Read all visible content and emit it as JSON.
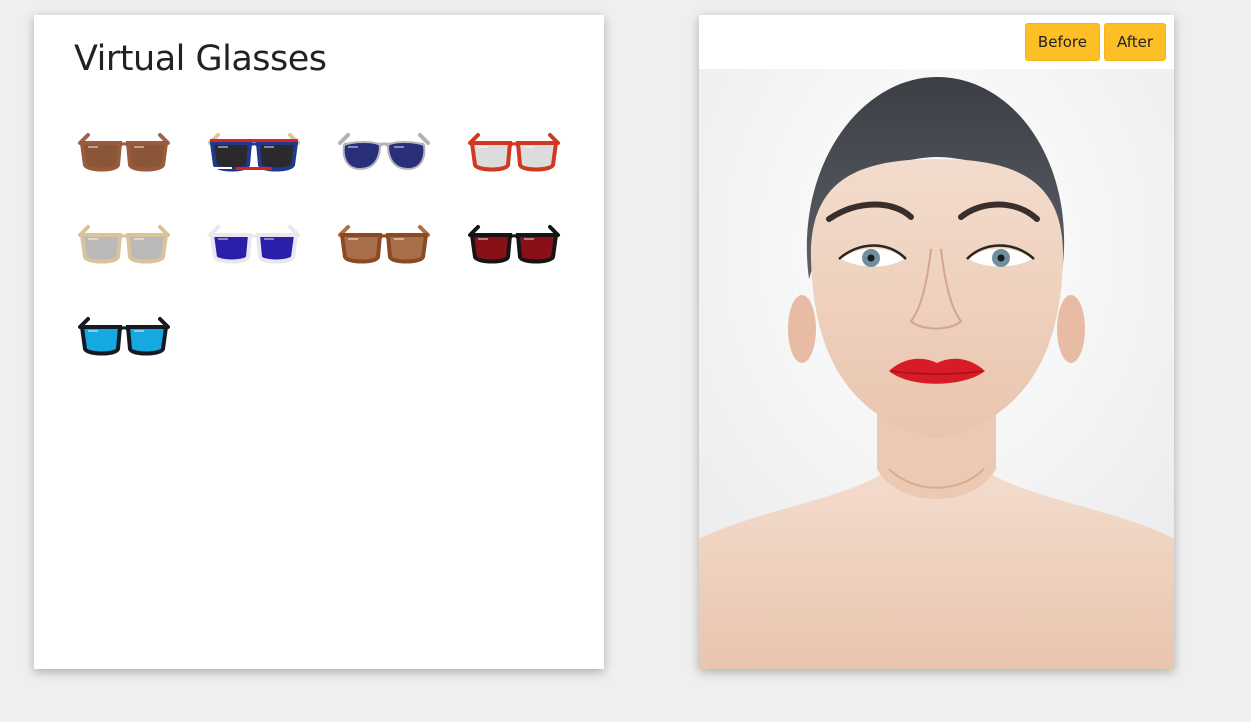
{
  "catalog": {
    "title": "Virtual Glasses",
    "glasses": [
      {
        "icon": "brown-wood-wayfarer-glasses-icon",
        "frame": "#9a5a3c",
        "lens": "#8a5638",
        "temple": "#a0654a",
        "style": "wayfarer"
      },
      {
        "icon": "us-flag-glasses-icon",
        "frame": "#1f3a8a",
        "lens": "#2a2a2e",
        "temple": "#e4c49a",
        "style": "flag"
      },
      {
        "icon": "navy-aviator-glasses-icon",
        "frame": "#b5b5bd",
        "lens": "#2a2f7a",
        "temple": "#b0b0b8",
        "style": "aviator"
      },
      {
        "icon": "red-frame-clear-glasses-icon",
        "frame": "#d0391f",
        "lens": "#dcdcdc",
        "temple": "#d0391f",
        "style": "clear"
      },
      {
        "icon": "wood-grey-lens-glasses-icon",
        "frame": "#d9c39a",
        "lens": "#b9b9b9",
        "temple": "#d9c39a",
        "style": "clear"
      },
      {
        "icon": "white-purple-lens-glasses-icon",
        "frame": "#e8e8ee",
        "lens": "#2a1fa8",
        "temple": "#e8e8ee",
        "style": "wayfarer"
      },
      {
        "icon": "tortoise-brown-glasses-icon",
        "frame": "#8b4a22",
        "lens": "#a8704a",
        "temple": "#b07040",
        "style": "wayfarer"
      },
      {
        "icon": "black-red-lens-glasses-icon",
        "frame": "#151515",
        "lens": "#8a1018",
        "temple": "#151515",
        "style": "wayfarer"
      },
      {
        "icon": "black-blue-mirror-glasses-icon",
        "frame": "#151a22",
        "lens": "#16a8e0",
        "temple": "#151a22",
        "style": "wayfarer"
      }
    ]
  },
  "preview": {
    "before_label": "Before",
    "after_label": "After",
    "photo_icon": "woman-portrait-icon"
  }
}
